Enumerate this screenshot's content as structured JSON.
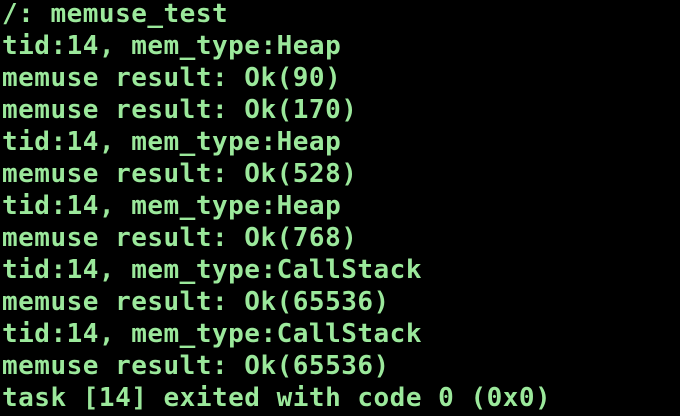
{
  "terminal": {
    "text_color": "#9be89b",
    "background_color": "#000000",
    "lines": [
      "/: memuse_test",
      "tid:14, mem_type:Heap",
      "memuse result: Ok(90)",
      "memuse result: Ok(170)",
      "tid:14, mem_type:Heap",
      "memuse result: Ok(528)",
      "tid:14, mem_type:Heap",
      "memuse result: Ok(768)",
      "tid:14, mem_type:CallStack",
      "memuse result: Ok(65536)",
      "tid:14, mem_type:CallStack",
      "memuse result: Ok(65536)",
      "task [14] exited with code 0 (0x0)"
    ]
  }
}
